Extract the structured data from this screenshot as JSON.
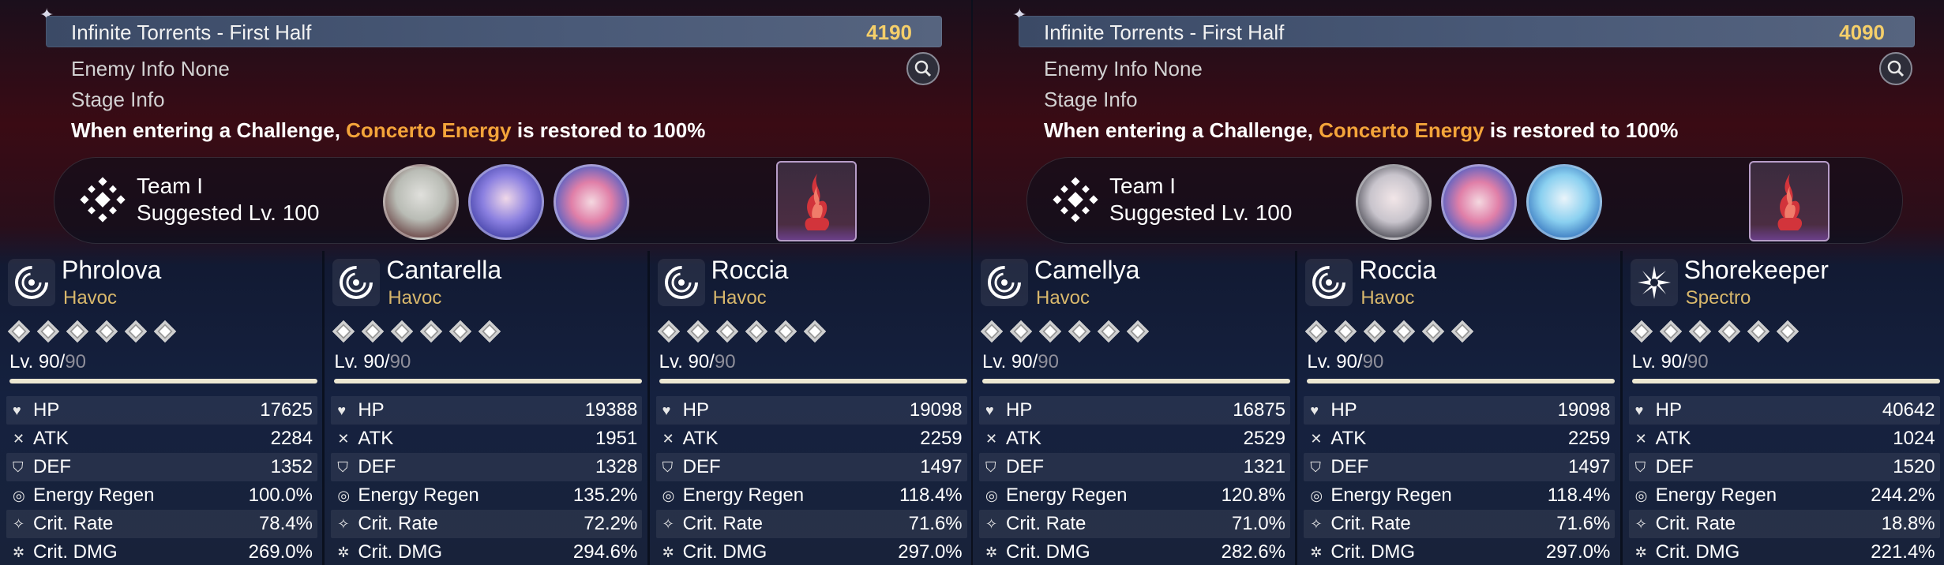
{
  "panels": [
    {
      "title": "Infinite Torrents - First Half",
      "score": "4190",
      "enemy_info": "Enemy Info  None",
      "stage_info": "Stage Info",
      "desc_pre": "When entering a Challenge, ",
      "desc_hl": "Concerto Energy",
      "desc_post": " is restored to 100%",
      "team": {
        "name": "Team I",
        "level": "Suggested Lv. 100"
      },
      "characters": [
        {
          "name": "Phrolova",
          "element": "Havoc",
          "lv": "Lv. 90/",
          "lvmax": "90",
          "stats": [
            {
              "icon": "hp-icon",
              "label": "HP",
              "value": "17625"
            },
            {
              "icon": "atk-icon",
              "label": "ATK",
              "value": "2284"
            },
            {
              "icon": "def-icon",
              "label": "DEF",
              "value": "1352"
            },
            {
              "icon": "energy-regen-icon",
              "label": "Energy Regen",
              "value": "100.0%"
            },
            {
              "icon": "crit-rate-icon",
              "label": "Crit. Rate",
              "value": "78.4%"
            },
            {
              "icon": "crit-dmg-icon",
              "label": "Crit. DMG",
              "value": "269.0%"
            }
          ]
        },
        {
          "name": "Cantarella",
          "element": "Havoc",
          "lv": "Lv. 90/",
          "lvmax": "90",
          "stats": [
            {
              "icon": "hp-icon",
              "label": "HP",
              "value": "19388"
            },
            {
              "icon": "atk-icon",
              "label": "ATK",
              "value": "1951"
            },
            {
              "icon": "def-icon",
              "label": "DEF",
              "value": "1328"
            },
            {
              "icon": "energy-regen-icon",
              "label": "Energy Regen",
              "value": "135.2%"
            },
            {
              "icon": "crit-rate-icon",
              "label": "Crit. Rate",
              "value": "72.2%"
            },
            {
              "icon": "crit-dmg-icon",
              "label": "Crit. DMG",
              "value": "294.6%"
            }
          ]
        },
        {
          "name": "Roccia",
          "element": "Havoc",
          "lv": "Lv. 90/",
          "lvmax": "90",
          "stats": [
            {
              "icon": "hp-icon",
              "label": "HP",
              "value": "19098"
            },
            {
              "icon": "atk-icon",
              "label": "ATK",
              "value": "2259"
            },
            {
              "icon": "def-icon",
              "label": "DEF",
              "value": "1497"
            },
            {
              "icon": "energy-regen-icon",
              "label": "Energy Regen",
              "value": "118.4%"
            },
            {
              "icon": "crit-rate-icon",
              "label": "Crit. Rate",
              "value": "71.6%"
            },
            {
              "icon": "crit-dmg-icon",
              "label": "Crit. DMG",
              "value": "297.0%"
            }
          ]
        }
      ]
    },
    {
      "title": "Infinite Torrents - First Half",
      "score": "4090",
      "enemy_info": "Enemy Info  None",
      "stage_info": "Stage Info",
      "desc_pre": "When entering a Challenge, ",
      "desc_hl": "Concerto Energy",
      "desc_post": " is restored to 100%",
      "team": {
        "name": "Team I",
        "level": "Suggested Lv. 100"
      },
      "characters": [
        {
          "name": "Camellya",
          "element": "Havoc",
          "lv": "Lv. 90/",
          "lvmax": "90",
          "stats": [
            {
              "icon": "hp-icon",
              "label": "HP",
              "value": "16875"
            },
            {
              "icon": "atk-icon",
              "label": "ATK",
              "value": "2529"
            },
            {
              "icon": "def-icon",
              "label": "DEF",
              "value": "1321"
            },
            {
              "icon": "energy-regen-icon",
              "label": "Energy Regen",
              "value": "120.8%"
            },
            {
              "icon": "crit-rate-icon",
              "label": "Crit. Rate",
              "value": "71.0%"
            },
            {
              "icon": "crit-dmg-icon",
              "label": "Crit. DMG",
              "value": "282.6%"
            }
          ]
        },
        {
          "name": "Roccia",
          "element": "Havoc",
          "lv": "Lv. 90/",
          "lvmax": "90",
          "stats": [
            {
              "icon": "hp-icon",
              "label": "HP",
              "value": "19098"
            },
            {
              "icon": "atk-icon",
              "label": "ATK",
              "value": "2259"
            },
            {
              "icon": "def-icon",
              "label": "DEF",
              "value": "1497"
            },
            {
              "icon": "energy-regen-icon",
              "label": "Energy Regen",
              "value": "118.4%"
            },
            {
              "icon": "crit-rate-icon",
              "label": "Crit. Rate",
              "value": "71.6%"
            },
            {
              "icon": "crit-dmg-icon",
              "label": "Crit. DMG",
              "value": "297.0%"
            }
          ]
        },
        {
          "name": "Shorekeeper",
          "element": "Spectro",
          "lv": "Lv. 90/",
          "lvmax": "90",
          "stats": [
            {
              "icon": "hp-icon",
              "label": "HP",
              "value": "40642"
            },
            {
              "icon": "atk-icon",
              "label": "ATK",
              "value": "1024"
            },
            {
              "icon": "def-icon",
              "label": "DEF",
              "value": "1520"
            },
            {
              "icon": "energy-regen-icon",
              "label": "Energy Regen",
              "value": "244.2%"
            },
            {
              "icon": "crit-rate-icon",
              "label": "Crit. Rate",
              "value": "18.8%"
            },
            {
              "icon": "crit-dmg-icon",
              "label": "Crit. DMG",
              "value": "221.4%"
            }
          ]
        }
      ]
    }
  ],
  "colors": {
    "accent_gold": "#f5cf6a",
    "highlight_orange": "#f3a43a",
    "havoc": "#d9b86c"
  }
}
